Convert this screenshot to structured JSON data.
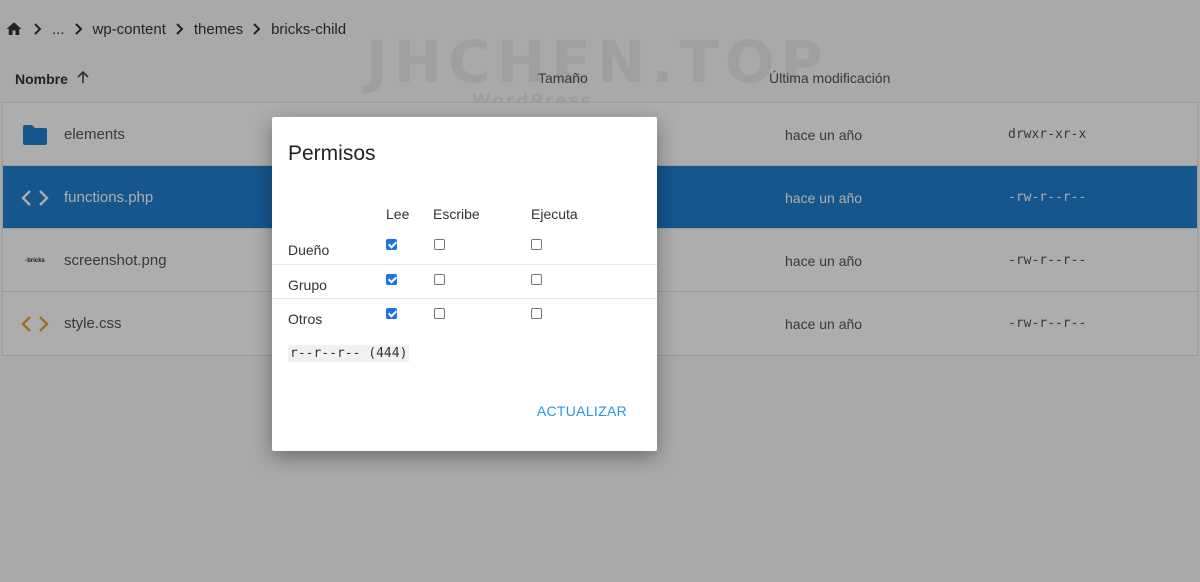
{
  "breadcrumb": {
    "items": [
      "...",
      "wp-content",
      "themes",
      "bricks-child"
    ]
  },
  "watermark": {
    "main": "JHCHEN.TOP",
    "sub": "WordPress"
  },
  "table": {
    "headers": {
      "name": "Nombre",
      "size": "Tamaño",
      "modified": "Última modificación"
    },
    "rows": [
      {
        "name": "elements",
        "modified": "hace un año",
        "permissions": "drwxr-xr-x",
        "icon": "folder-icon"
      },
      {
        "name": "functions.php",
        "modified": "hace un año",
        "permissions": "-rw-r--r--",
        "icon": "code-icon"
      },
      {
        "name": "screenshot.png",
        "modified": "hace un año",
        "permissions": "-rw-r--r--",
        "icon": "image-thumbnail-icon"
      },
      {
        "name": "style.css",
        "modified": "hace un año",
        "permissions": "-rw-r--r--",
        "icon": "code-icon"
      }
    ],
    "thumbnail_text": "bricks"
  },
  "dialog": {
    "title": "Permisos",
    "columns": [
      "Lee",
      "Escribe",
      "Ejecuta"
    ],
    "rows": [
      {
        "label": "Dueño",
        "read": true,
        "write": false,
        "execute": false
      },
      {
        "label": "Grupo",
        "read": true,
        "write": false,
        "execute": false
      },
      {
        "label": "Otros",
        "read": true,
        "write": false,
        "execute": false
      }
    ],
    "summary": "r--r--r-- (444)",
    "update_label": "ACTUALIZAR"
  },
  "colors": {
    "selected_row": "#1f7fd0",
    "folder": "#1f7fd0",
    "code_icon_blue": "#ffffff",
    "code_icon_orange": "#e8a23a",
    "accent": "#2196f3",
    "checkbox": "#1a73e8"
  }
}
